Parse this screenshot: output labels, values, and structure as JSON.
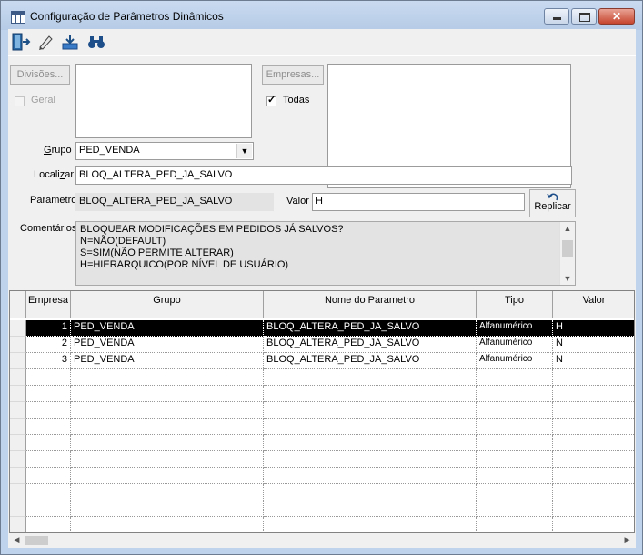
{
  "window": {
    "title": "Configuração de Parâmetros Dinâmicos",
    "controls": {
      "minimize_icon": "minimize-icon",
      "maximize_icon": "maximize-icon",
      "close_icon": "close-icon"
    }
  },
  "toolbar": {
    "buttons": [
      {
        "icon": "exit-door-icon"
      },
      {
        "icon": "pencil-eraser-icon"
      },
      {
        "icon": "save-download-icon"
      },
      {
        "icon": "binoculars-icon"
      }
    ]
  },
  "filters": {
    "divisoes_label": "Divisões...",
    "geral_label": "Geral",
    "geral_checked": false,
    "empresas_label": "Empresas...",
    "todas_label": "Todas",
    "todas_checked": true,
    "grupo_label": "Grupo",
    "grupo_value": "PED_VENDA",
    "localizar_label": "Localizar",
    "localizar_value": "BLOQ_ALTERA_PED_JA_SALVO"
  },
  "detail": {
    "parametro_label": "Parametro",
    "parametro_value": "BLOQ_ALTERA_PED_JA_SALVO",
    "valor_label": "Valor",
    "valor_value": "H",
    "replicar_label": "Replicar",
    "comentarios_label": "Comentários",
    "comentarios_lines": [
      "BLOQUEAR MODIFICAÇÕES EM PEDIDOS JÁ SALVOS?",
      "N=NÃO(DEFAULT)",
      "S=SIM(NÃO PERMITE ALTERAR)",
      "H=HIERARQUICO(POR NÍVEL DE USUÁRIO)"
    ]
  },
  "table": {
    "columns": [
      "Empresa",
      "Grupo",
      "Nome do Parametro",
      "Tipo",
      "Valor"
    ],
    "rows": [
      {
        "empresa": "1",
        "grupo": "PED_VENDA",
        "nome": "BLOQ_ALTERA_PED_JA_SALVO",
        "tipo": "Alfanumérico",
        "valor": "H",
        "selected": true
      },
      {
        "empresa": "2",
        "grupo": "PED_VENDA",
        "nome": "BLOQ_ALTERA_PED_JA_SALVO",
        "tipo": "Alfanumérico",
        "valor": "N",
        "selected": false
      },
      {
        "empresa": "3",
        "grupo": "PED_VENDA",
        "nome": "BLOQ_ALTERA_PED_JA_SALVO",
        "tipo": "Alfanumérico",
        "valor": "N",
        "selected": false
      }
    ]
  }
}
